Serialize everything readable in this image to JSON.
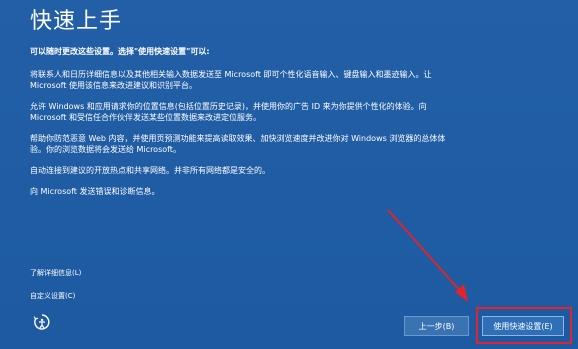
{
  "page": {
    "title": "快速上手",
    "intro": "可以随时更改这些设置。选择\"使用快速设置\"可以:",
    "paragraphs": [
      "将联系人和日历详细信息以及其他相关输入数据发送至 Microsoft 即可个性化语音输入、键盘输入和墨迹输入。让 Microsoft 使用该信息来改进建议和识别平台。",
      "允许 Windows 和应用请求你的位置信息(包括位置历史记录)，并使用你的广告 ID 来为你提供个性化的体验。向 Microsoft 和受信任合作伙伴发送某些位置数据来改进定位服务。",
      "帮助你防范恶意 Web 内容，并使用页预测功能来提高读取效果、加快浏览速度并改进你对 Windows 浏览器的总体体验。你的浏览数据将会发送给 Microsoft。",
      "自动连接到建议的开放热点和共享网络。并非所有网络都是安全的。",
      "向 Microsoft 发送错误和诊断信息。"
    ]
  },
  "links": {
    "learn_more": "了解详细信息(L)",
    "customize": "自定义设置(C)"
  },
  "buttons": {
    "back": "上一步(B)",
    "express": "使用快速设置(E)"
  },
  "icons": {
    "ease_of_access": "ease-of-access-icon"
  },
  "colors": {
    "background": "#1f5fa8",
    "annotation": "#e3232b"
  }
}
